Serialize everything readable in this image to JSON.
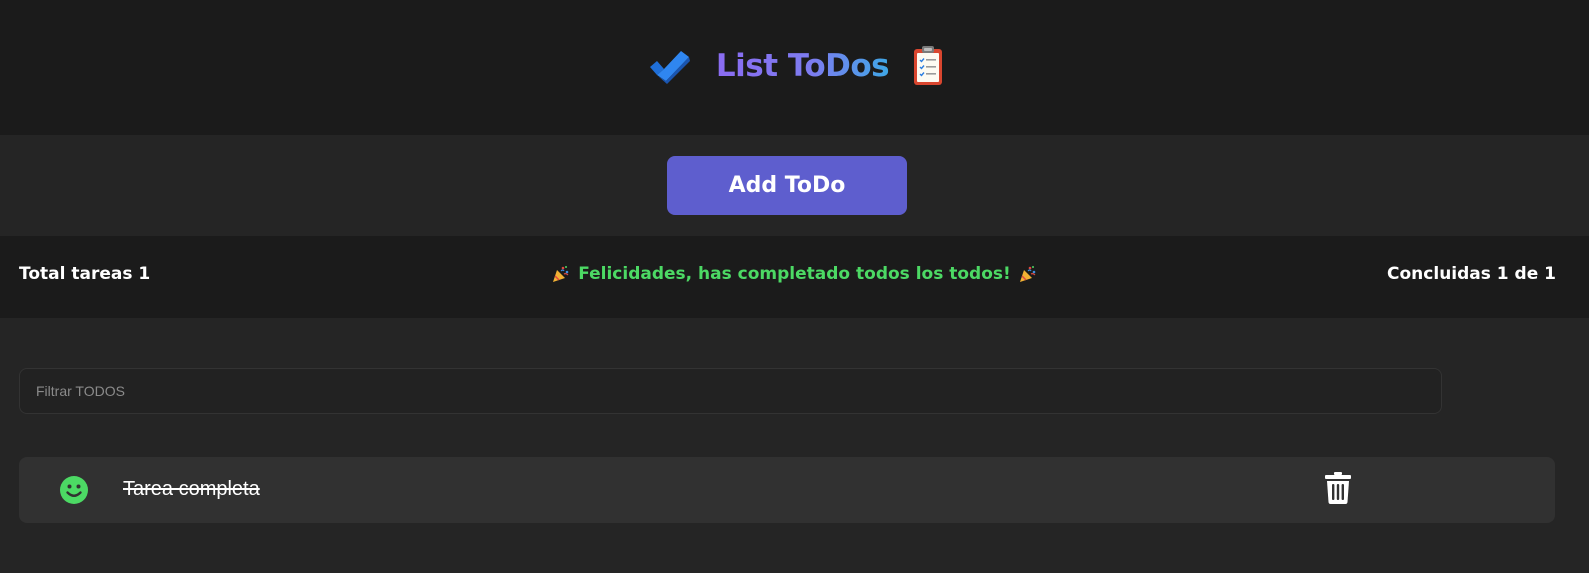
{
  "header": {
    "title": "List ToDos",
    "left_icon": "double-check-icon",
    "right_icon": "clipboard-icon",
    "title_gradient": [
      "#8b6cf2",
      "#3fa7e6"
    ]
  },
  "toolbar": {
    "add_label": "Add ToDo",
    "accent": "#5e5ece"
  },
  "stats": {
    "total_label": "Total tareas 1",
    "congrats_message": "Felicidades, has completado todos los todos!",
    "congrats_icon": "party-popper-icon",
    "done_label": "Concluidas 1 de 1",
    "success_color": "#4cd964"
  },
  "filter": {
    "placeholder": "Filtrar TODOS",
    "value": ""
  },
  "todos": [
    {
      "text": "Tarea completa",
      "completed": true,
      "status_icon": "smile-icon",
      "action_icon": "trash-icon"
    }
  ]
}
